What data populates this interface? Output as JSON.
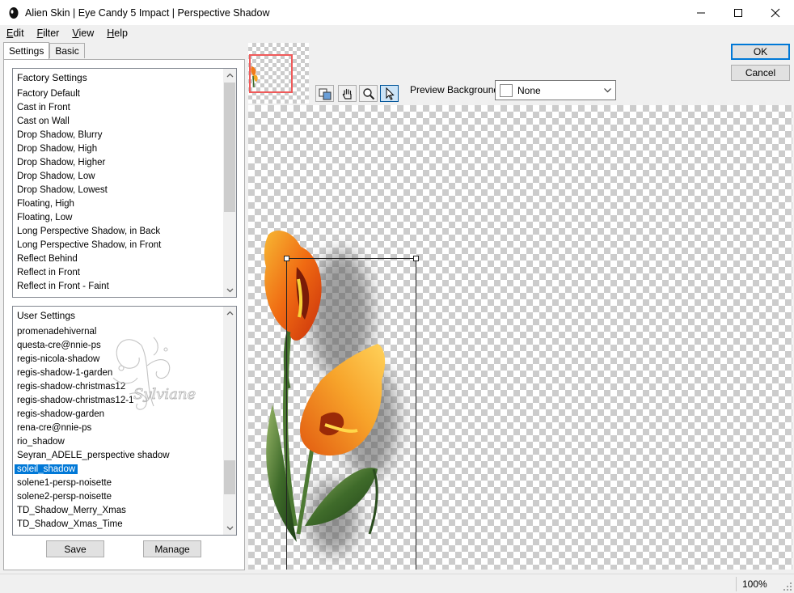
{
  "window": {
    "title": "Alien Skin | Eye Candy 5 Impact | Perspective Shadow"
  },
  "menu": [
    {
      "label": "Edit",
      "first": "E",
      "rest": "dit"
    },
    {
      "label": "Filter",
      "first": "F",
      "rest": "ilter"
    },
    {
      "label": "View",
      "first": "V",
      "rest": "iew"
    },
    {
      "label": "Help",
      "first": "H",
      "rest": "elp"
    }
  ],
  "tabs": {
    "settings": "Settings",
    "basic": "Basic"
  },
  "factory": {
    "header": "Factory Settings",
    "items": [
      "Factory Default",
      "Cast in Front",
      "Cast on Wall",
      "Drop Shadow, Blurry",
      "Drop Shadow, High",
      "Drop Shadow, Higher",
      "Drop Shadow, Low",
      "Drop Shadow, Lowest",
      "Floating, High",
      "Floating, Low",
      "Long Perspective Shadow, in Back",
      "Long Perspective Shadow, in Front",
      "Reflect Behind",
      "Reflect in Front",
      "Reflect in Front - Faint"
    ]
  },
  "user": {
    "header": "User Settings",
    "items": [
      "promenadehivernal",
      "questa-cre@nnie-ps",
      "regis-nicola-shadow",
      "regis-shadow-1-garden",
      "regis-shadow-christmas12",
      "regis-shadow-christmas12-1",
      "regis-shadow-garden",
      "rena-cre@nnie-ps",
      "rio_shadow",
      "Seyran_ADELE_perspective shadow",
      "soleil_shadow",
      "solene1-persp-noisette",
      "solene2-persp-noisette",
      "TD_Shadow_Merry_Xmas",
      "TD_Shadow_Xmas_Time"
    ],
    "selected_index": 10
  },
  "buttons": {
    "save": "Save",
    "manage": "Manage",
    "ok": "OK",
    "cancel": "Cancel"
  },
  "preview": {
    "background_label": "Preview Background:",
    "background_value": "None",
    "watermark": "Sylviane"
  },
  "status": {
    "zoom": "100%"
  },
  "colors": {
    "selection": "#0078d7",
    "nav_frame": "#f05a5a"
  }
}
